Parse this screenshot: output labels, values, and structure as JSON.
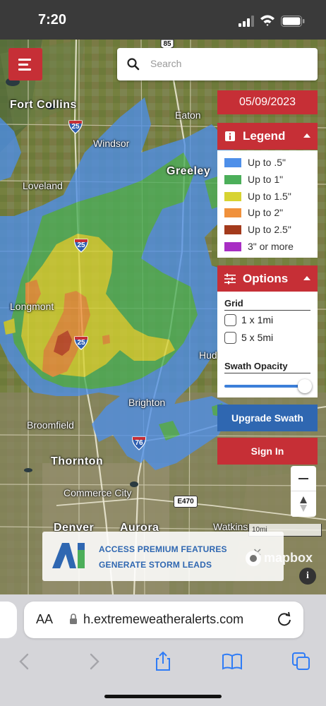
{
  "status_bar": {
    "time": "7:20"
  },
  "search": {
    "placeholder": "Search"
  },
  "date": "05/09/2023",
  "legend": {
    "title": "Legend",
    "items": [
      {
        "label": "Up to .5\"",
        "color": "#4e8fe9"
      },
      {
        "label": "Up to 1\"",
        "color": "#4caf5a"
      },
      {
        "label": "Up to 1.5\"",
        "color": "#d7d332"
      },
      {
        "label": "Up to 2\"",
        "color": "#f0913c"
      },
      {
        "label": "Up to 2.5\"",
        "color": "#a33a1c"
      },
      {
        "label": "3\" or more",
        "color": "#a82ec4"
      }
    ]
  },
  "options": {
    "title": "Options",
    "grid_title": "Grid",
    "grid_1": "1 x 1mi",
    "grid_5": "5 x 5mi",
    "opacity_title": "Swath Opacity",
    "opacity_value": 1.0
  },
  "buttons": {
    "upgrade": "Upgrade Swath",
    "signin": "Sign In"
  },
  "map": {
    "cities": {
      "fort_collins": "Fort Collins",
      "eaton": "Eaton",
      "windsor": "Windsor",
      "greeley": "Greeley",
      "loveland": "Loveland",
      "longmont": "Longmont",
      "hudson": "Hud",
      "brighton": "Brighton",
      "broomfield": "Broomfield",
      "thornton": "Thornton",
      "commerce_city": "Commerce City",
      "denver": "Denver",
      "aurora": "Aurora",
      "watkins": "Watkins"
    },
    "shields": {
      "i25_north": "25",
      "i25_mid": "25",
      "i25_south": "25",
      "i76": "76",
      "us85": "85"
    },
    "e470": "E470",
    "scale": "10mi",
    "attribution": "mapbox"
  },
  "ad": {
    "line1": "ACCESS PREMIUM FEATURES",
    "line2": "GENERATE STORM LEADS",
    "close": "✕"
  },
  "browser": {
    "text_size": "AA",
    "url": "h.extremeweatheralerts.com"
  },
  "colors": {
    "brand_red": "#c62f36",
    "brand_blue": "#2f67b1"
  }
}
